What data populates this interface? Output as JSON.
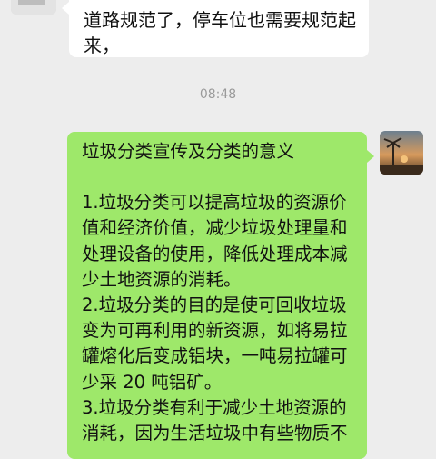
{
  "chat": {
    "messages": [
      {
        "side": "left",
        "lines": [
          "道路规范了，停车位也需要规范起",
          "来，"
        ]
      },
      {
        "side": "right",
        "title": "垃圾分类宣传及分类的意义",
        "lines": [
          "1.垃圾分类可以提高垃圾的资源价",
          "值和经济价值，减少垃圾处理量和",
          "处理设备的使用，降低处理成本减",
          "少土地资源的消耗。",
          "2.垃圾分类的目的是使可回收垃圾",
          "变为可再利用的新资源，如将易拉",
          "罐熔化后变成铝块，一吨易拉罐可",
          "少采 20 吨铝矿。",
          "3.垃圾分类有利于减少土地资源的",
          "消耗，因为生活垃圾中有些物质不"
        ]
      }
    ],
    "timestamp": "08:48"
  }
}
